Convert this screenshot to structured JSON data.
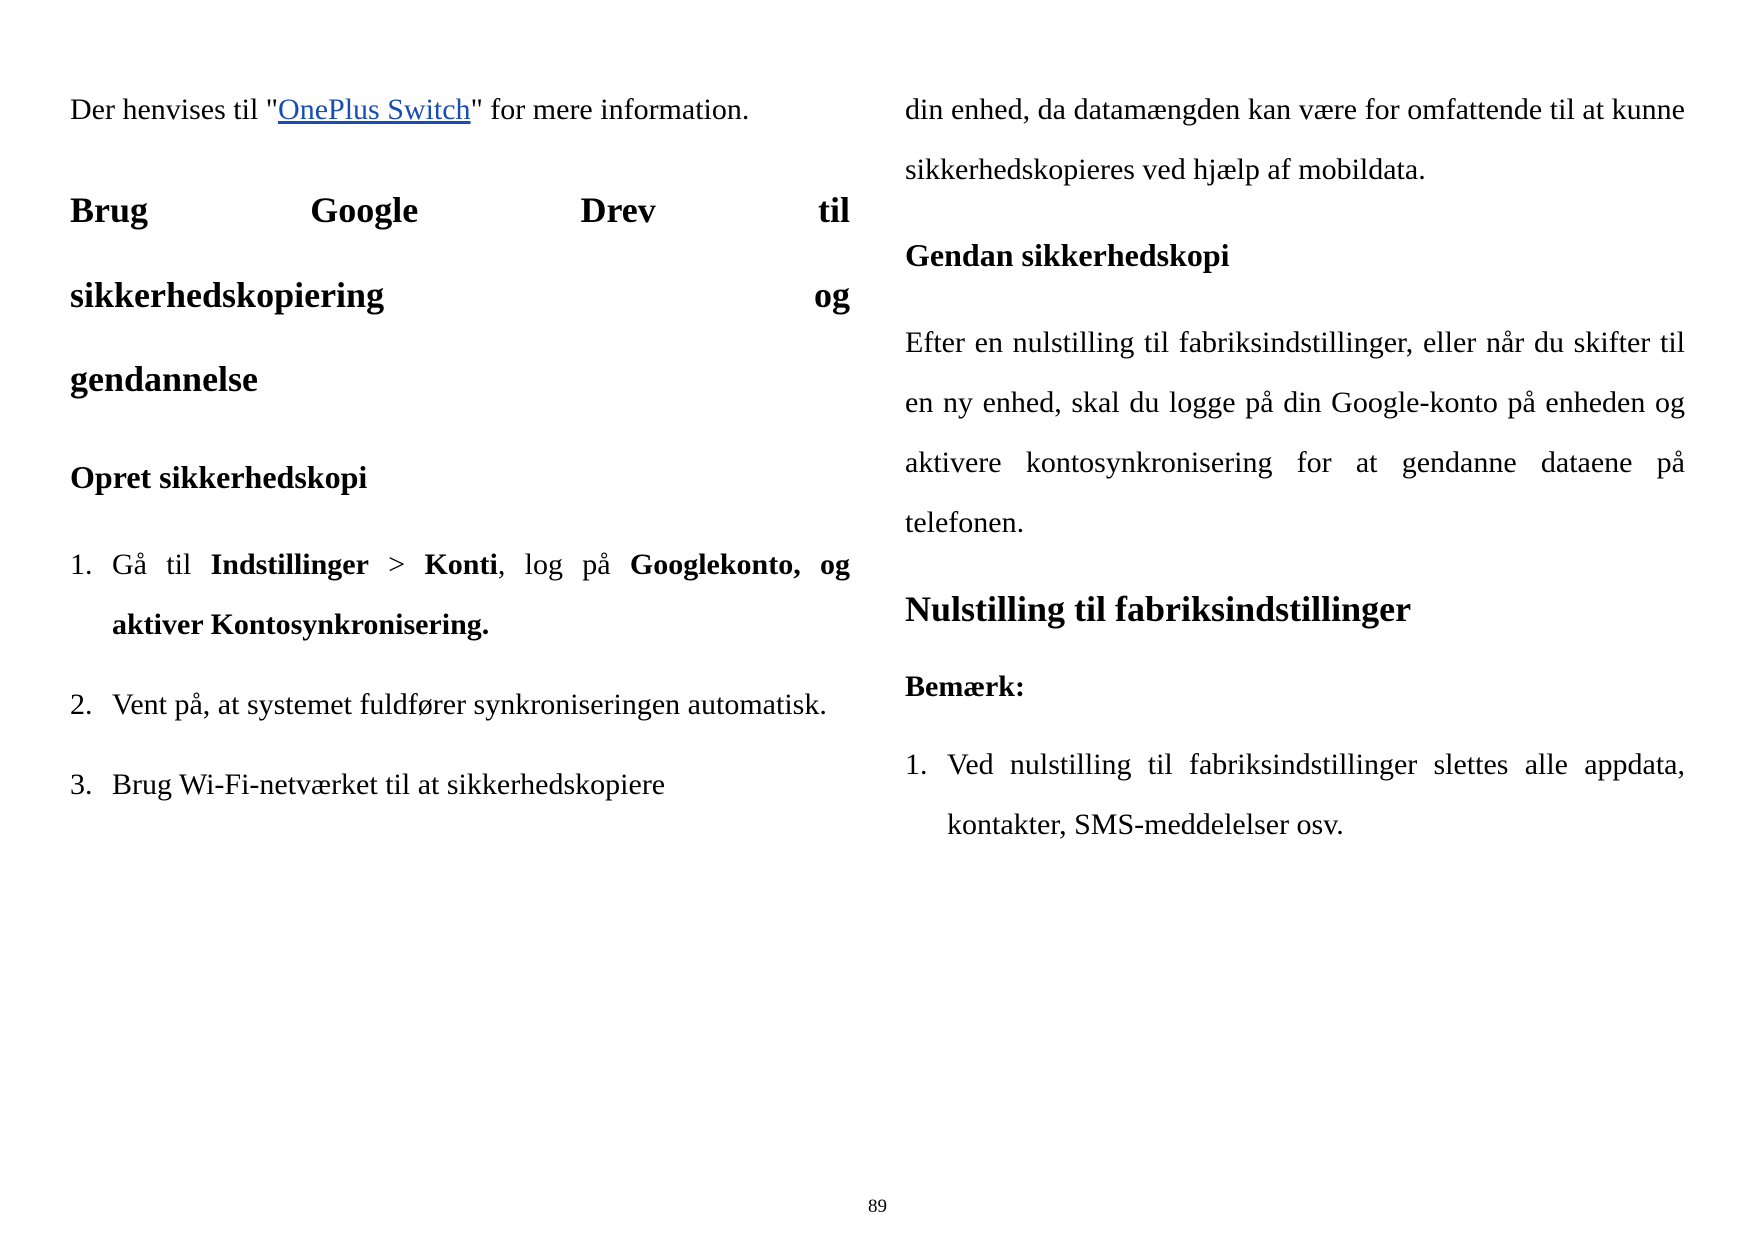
{
  "page_number": "89",
  "left": {
    "intro": {
      "pre": "Der henvises til \"",
      "link": "OnePlus Switch",
      "post": "\" for mere information."
    },
    "heading_main": "Brug Google Drev til sikkerhedskopiering og gendannelse",
    "heading_main_line1": "Brug Google Drev til",
    "heading_main_line2": "sikkerhedskopiering og",
    "heading_main_line3": "gendannelse",
    "heading_sub1": "Opret sikkerhedskopi",
    "steps": [
      {
        "t1": "Gå til ",
        "b1": "Indstillinger",
        "t2": " > ",
        "b2": "Konti",
        "t3": ", log på ",
        "b3": "Googlekonto, og aktiver Kontosynkronisering.",
        "t4": ""
      },
      {
        "t1": "Vent på, at systemet fuldfører synkroniseringen automatisk.",
        "b1": "",
        "t2": "",
        "b2": "",
        "t3": "",
        "b3": "",
        "t4": ""
      },
      {
        "t1": "Brug Wi-Fi-netværket til at sikkerhedskopiere",
        "b1": "",
        "t2": "",
        "b2": "",
        "t3": "",
        "b3": "",
        "t4": ""
      }
    ]
  },
  "right": {
    "continuation": "din enhed, da datamængden kan være for omfattende til at kunne sikkerhedskopieres ved hjælp af mobildata.",
    "heading_sub2": "Gendan sikkerhedskopi",
    "para_restore": "Efter en nulstilling til fabriksindstillinger, eller når du skifter til en ny enhed, skal du logge på din Google-konto på enheden og aktivere kontosynkronisering for at gendanne dataene på telefonen.",
    "heading_main2": "Nulstilling til fabriksindstillinger",
    "note_label": "Bemærk:",
    "note_items": [
      "Ved nulstilling til fabriksindstillinger slettes alle appdata, kontakter, SMS-meddelelser osv."
    ]
  }
}
